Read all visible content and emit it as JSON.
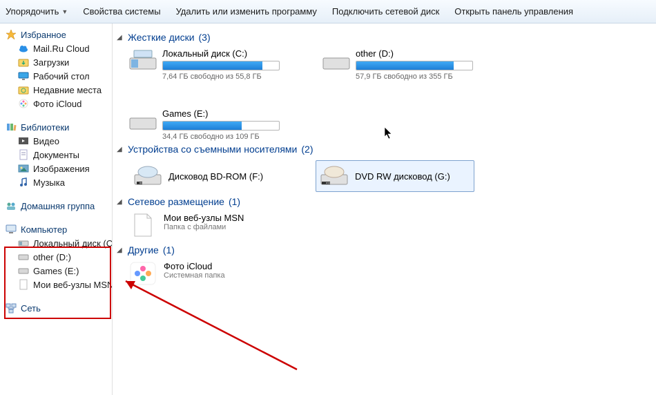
{
  "toolbar": {
    "organize": "Упорядочить",
    "properties": "Свойства системы",
    "uninstall": "Удалить или изменить программу",
    "map_drive": "Подключить сетевой диск",
    "control_panel": "Открыть панель управления"
  },
  "sidebar": {
    "favorites": {
      "header": "Избранное",
      "items": [
        {
          "label": "Mail.Ru Cloud"
        },
        {
          "label": "Загрузки"
        },
        {
          "label": "Рабочий стол"
        },
        {
          "label": "Недавние места"
        },
        {
          "label": "Фото iCloud"
        }
      ]
    },
    "libraries": {
      "header": "Библиотеки",
      "items": [
        {
          "label": "Видео"
        },
        {
          "label": "Документы"
        },
        {
          "label": "Изображения"
        },
        {
          "label": "Музыка"
        }
      ]
    },
    "homegroup": {
      "header": "Домашняя группа"
    },
    "computer": {
      "header": "Компьютер",
      "items": [
        {
          "label": "Локальный диск (C:)"
        },
        {
          "label": "other (D:)"
        },
        {
          "label": "Games (E:)"
        },
        {
          "label": "Мои веб-узлы MSN"
        }
      ]
    },
    "network": {
      "header": "Сеть"
    }
  },
  "sections": {
    "hdd": {
      "title": "Жесткие диски",
      "count": "(3)"
    },
    "removable": {
      "title": "Устройства со съемными носителями",
      "count": "(2)"
    },
    "netloc": {
      "title": "Сетевое размещение",
      "count": "(1)"
    },
    "other": {
      "title": "Другие",
      "count": "(1)"
    }
  },
  "drives": [
    {
      "name": "Локальный диск (C:)",
      "sub": "7,64 ГБ свободно из 55,8 ГБ",
      "fill": 86
    },
    {
      "name": "other (D:)",
      "sub": "57,9 ГБ свободно из 355 ГБ",
      "fill": 84
    },
    {
      "name": "Games (E:)",
      "sub": "34,4 ГБ свободно из 109 ГБ",
      "fill": 68
    }
  ],
  "removables": [
    {
      "name": "Дисковод BD-ROM (F:)"
    },
    {
      "name": "DVD RW дисковод (G:)"
    }
  ],
  "netloc": {
    "name": "Мои веб-узлы MSN",
    "sub": "Папка с файлами"
  },
  "other_item": {
    "name": "Фото iCloud",
    "sub": "Системная папка"
  }
}
